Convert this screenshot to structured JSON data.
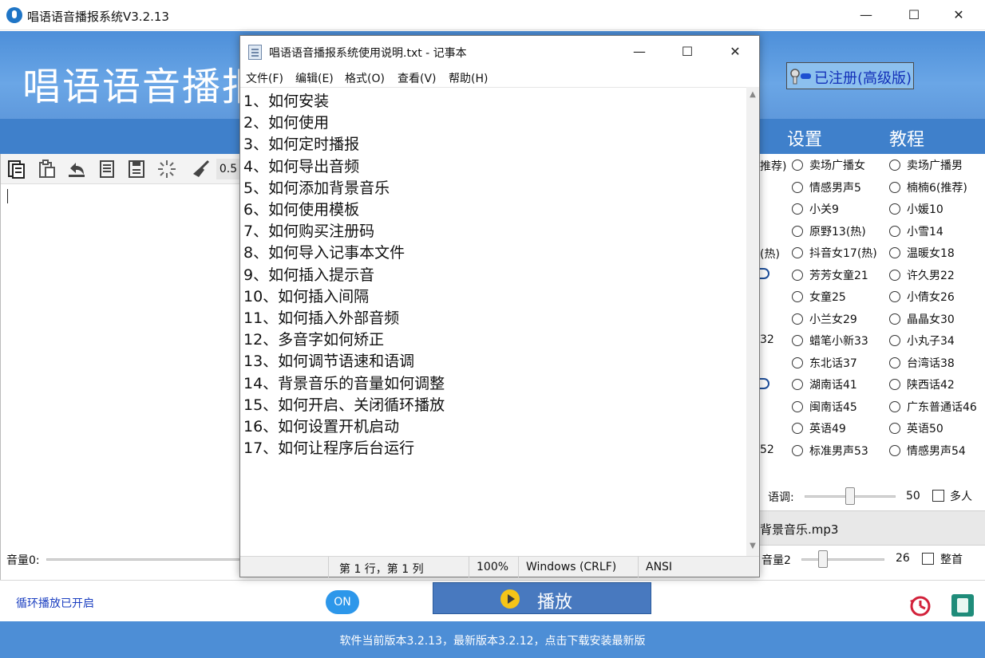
{
  "app": {
    "window_title": "唱语语音播报系统V3.2.13",
    "brand_partial": "唱语语音播报",
    "registered_label": "已注册(高级版)",
    "nav": [
      "设置",
      "教程"
    ],
    "speed_value": "0.5",
    "volume_label": "音量0:",
    "voices": [
      {
        "label": "卖场广播女",
        "col": 0,
        "row": 0
      },
      {
        "label": "卖场广播男",
        "col": 1,
        "row": 0
      },
      {
        "label": "情感男声5",
        "col": 0,
        "row": 1
      },
      {
        "label": "楠楠6(推荐)",
        "col": 1,
        "row": 1
      },
      {
        "label": "小关9",
        "col": 0,
        "row": 2
      },
      {
        "label": "小媛10",
        "col": 1,
        "row": 2
      },
      {
        "label": "原野13(热)",
        "col": 0,
        "row": 3
      },
      {
        "label": "小雪14",
        "col": 1,
        "row": 3
      },
      {
        "label": "抖音女17(热)",
        "col": 0,
        "row": 4
      },
      {
        "label": "温暖女18",
        "col": 1,
        "row": 4
      },
      {
        "label": "芳芳女童21",
        "col": 0,
        "row": 5
      },
      {
        "label": "许久男22",
        "col": 1,
        "row": 5
      },
      {
        "label": "女童25",
        "col": 0,
        "row": 6
      },
      {
        "label": "小倩女26",
        "col": 1,
        "row": 6
      },
      {
        "label": "小兰女29",
        "col": 0,
        "row": 7
      },
      {
        "label": "晶晶女30",
        "col": 1,
        "row": 7
      },
      {
        "label": "蜡笔小新33",
        "col": 0,
        "row": 8
      },
      {
        "label": "小丸子34",
        "col": 1,
        "row": 8
      },
      {
        "label": "东北话37",
        "col": 0,
        "row": 9
      },
      {
        "label": "台湾话38",
        "col": 1,
        "row": 9
      },
      {
        "label": "湖南话41",
        "col": 0,
        "row": 10
      },
      {
        "label": "陕西话42",
        "col": 1,
        "row": 10
      },
      {
        "label": "闽南话45",
        "col": 0,
        "row": 11
      },
      {
        "label": "广东普通话46",
        "col": 1,
        "row": 11
      },
      {
        "label": "英语49",
        "col": 0,
        "row": 12
      },
      {
        "label": "英语50",
        "col": 1,
        "row": 12
      },
      {
        "label": "标准男声53",
        "col": 0,
        "row": 13
      },
      {
        "label": "情感男声54",
        "col": 1,
        "row": 13
      }
    ],
    "voice_fragments": {
      "row0": "推荐)",
      "row4": "(热)",
      "row8": "32",
      "row13": "52"
    },
    "tone_label": "语调:",
    "tone_value": "50",
    "tone_value_fraction": 0.5,
    "multi_label": "多人",
    "bgm_label": "背景音乐.mp3",
    "volume2_label": "音量2",
    "volume2_value": "26",
    "volume2_fraction": 0.26,
    "whole_label": "整首",
    "loop_status": "循环播放已开启",
    "loop_toggle": "ON",
    "play_label": "播放",
    "footer_text": "软件当前版本3.2.13，最新版本3.2.12，点击下载安装最新版",
    "colors": {
      "banner": "#5f99dc",
      "nav": "#3f80cb",
      "footer": "#4d8ed6",
      "play": "#4879bf",
      "toggle": "#2d97ea"
    }
  },
  "notepad": {
    "title": "唱语语音播报系统使用说明.txt - 记事本",
    "menu": [
      "文件(F)",
      "编辑(E)",
      "格式(O)",
      "查看(V)",
      "帮助(H)"
    ],
    "lines": [
      "1、如何安装",
      "2、如何使用",
      "3、如何定时播报",
      "4、如何导出音频",
      "5、如何添加背景音乐",
      "6、如何使用模板",
      "7、如何购买注册码",
      "8、如何导入记事本文件",
      "9、如何插入提示音",
      "10、如何插入间隔",
      "11、如何插入外部音频",
      "12、多音字如何矫正",
      "13、如何调节语速和语调",
      "14、背景音乐的音量如何调整",
      "15、如何开启、关闭循环播放",
      "16、如何设置开机启动",
      "17、如何让程序后台运行"
    ],
    "status": {
      "position": "第 1 行，第 1 列",
      "zoom": "100%",
      "line_ending": "Windows (CRLF)",
      "encoding": "ANSI"
    }
  }
}
